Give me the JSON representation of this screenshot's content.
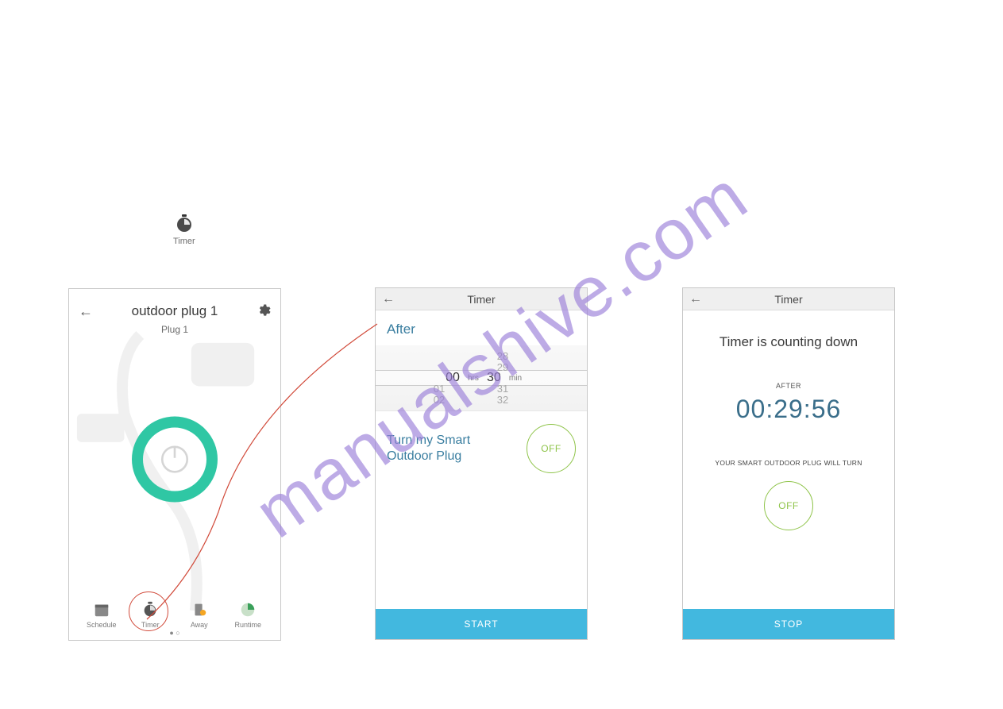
{
  "watermark": "manualshive.com",
  "timer_icon_block": {
    "label": "Timer"
  },
  "screen1": {
    "title": "outdoor plug 1",
    "subtitle": "Plug 1",
    "tabs": [
      "Schedule",
      "Timer",
      "Away",
      "Runtime"
    ]
  },
  "screen2": {
    "header": "Timer",
    "after": "After",
    "picker": {
      "hrs_unit": "hrs",
      "min_unit": "min",
      "hrs_values": [
        "00",
        "01",
        "02"
      ],
      "min_values_above": [
        "28",
        "29"
      ],
      "min_selected": "30",
      "min_values_below": [
        "31",
        "32"
      ],
      "hrs_selected": "00"
    },
    "action_text_line1": "Turn my Smart",
    "action_text_line2": "Outdoor Plug",
    "off_label": "OFF",
    "start": "START"
  },
  "screen3": {
    "header": "Timer",
    "heading": "Timer is counting down",
    "after_label": "AFTER",
    "countdown": "00:29:56",
    "caption": "YOUR SMART OUTDOOR PLUG WILL TURN",
    "off_label": "OFF",
    "stop": "STOP"
  }
}
